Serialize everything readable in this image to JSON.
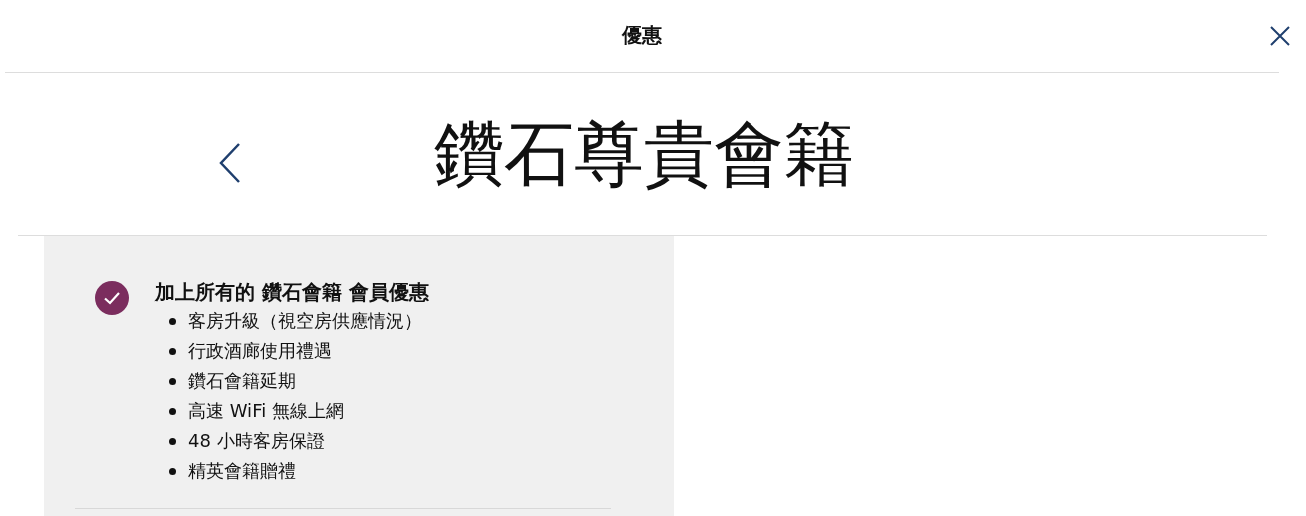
{
  "header": {
    "title": "優惠"
  },
  "page_title": "鑽石尊貴會籍",
  "benefit": {
    "checked": true,
    "title": "加上所有的 鑽石會籍 會員優惠",
    "items": [
      "客房升級（視空房供應情況）",
      "行政酒廊使用禮遇",
      "鑽石會籍延期",
      "高速 WiFi 無線上網",
      "48 小時客房保證",
      "精英會籍贈禮"
    ]
  }
}
